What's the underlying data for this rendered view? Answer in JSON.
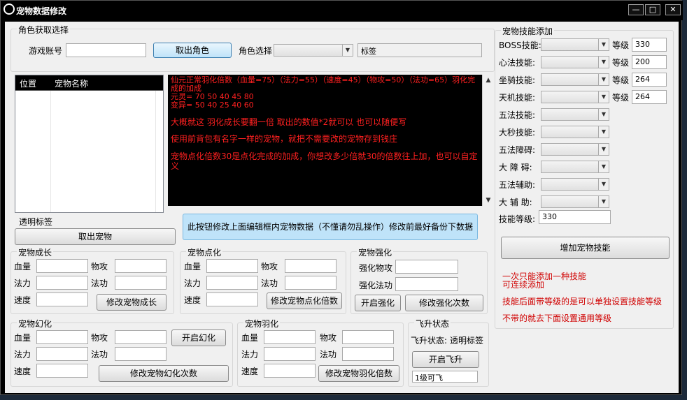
{
  "window": {
    "title": "宠物数据修改",
    "min": "—",
    "max": "□",
    "close": "✕"
  },
  "role": {
    "group": "角色获取选择",
    "account_label": "游戏账号",
    "account_value": "",
    "fetch_role_btn": "取出角色",
    "role_select_label": "角色选择",
    "role_select_value": "",
    "tag_field": "标签"
  },
  "pet_list": {
    "col_pos": "位置",
    "col_name": "宠物名称",
    "rows": []
  },
  "notes": {
    "line1": "仙元正常羽化倍数（血量=75）（法力=55）（速度=45）（物攻=50）（法功=65）羽化完成的加成",
    "line2": "元灵=  70 50  40  45  80",
    "line3": "变异=  50 40  25  40  60",
    "line4": "大概就这  羽化成长要翻一倍  取出的数值*2就可以  也可以随便写",
    "line5": "使用前背包有名字一样的宠物，就把不需要改的宠物存到钱庄",
    "line6": "宠物点化倍数30是点化完成的加成，你想改多少倍就30的倍数往上加，也可以自定义"
  },
  "transparent_tag": "透明标签",
  "fetch_pet_btn": "取出宠物",
  "info_text": "此按钮修改上面编辑框内宠物数据（不懂请勿乱操作）修改前最好备份下数据",
  "growth": {
    "group": "宠物成长",
    "hp": "血量",
    "patk": "物攻",
    "mp": "法力",
    "matk": "法功",
    "speed": "速度",
    "btn": "修改宠物成长"
  },
  "dianhua": {
    "group": "宠物点化",
    "hp": "血量",
    "patk": "物攻",
    "mp": "法力",
    "matk": "法功",
    "speed": "速度",
    "btn": "修改宠物点化倍数"
  },
  "qianghua": {
    "group": "宠物强化",
    "patk": "强化物攻",
    "matk": "强化法功",
    "open_btn": "开启强化",
    "btn": "修改强化次数"
  },
  "huanhua": {
    "group": "宠物幻化",
    "hp": "血量",
    "patk": "物攻",
    "mp": "法力",
    "matk": "法功",
    "speed": "速度",
    "open_btn": "开启幻化",
    "btn": "修改宠物幻化次数"
  },
  "yuhua": {
    "group": "宠物羽化",
    "hp": "血量",
    "patk": "物攻",
    "mp": "法力",
    "matk": "法功",
    "speed": "速度",
    "btn": "修改宠物羽化倍数"
  },
  "feisheng": {
    "group": "飞升状态",
    "status_label": "飞升状态:",
    "status_value": "透明标签",
    "open_btn": "开启飞升",
    "level_value": "1级可飞"
  },
  "skills": {
    "group": "宠物技能添加",
    "level_word": "等级",
    "items": [
      {
        "label": "BOSS技能:",
        "level": "330"
      },
      {
        "label": "心法技能:",
        "level": "200"
      },
      {
        "label": "坐骑技能:",
        "level": "264"
      },
      {
        "label": "天机技能:",
        "level": "264"
      },
      {
        "label": "五法技能:"
      },
      {
        "label": "大秒技能:"
      },
      {
        "label": "五法障碍:"
      },
      {
        "label": "大 障 碍:"
      },
      {
        "label": "五法辅助:"
      },
      {
        "label": "大 辅 助:"
      }
    ],
    "skill_level_label": "技能等级:",
    "skill_level_value": "330",
    "add_btn": "增加宠物技能",
    "tip1": "一次只能添加一种技能",
    "tip2": "可连续添加",
    "tip3": "技能后面带等级的是可以单独设置技能等级",
    "tip4": "不带的就去下面设置通用等级"
  }
}
